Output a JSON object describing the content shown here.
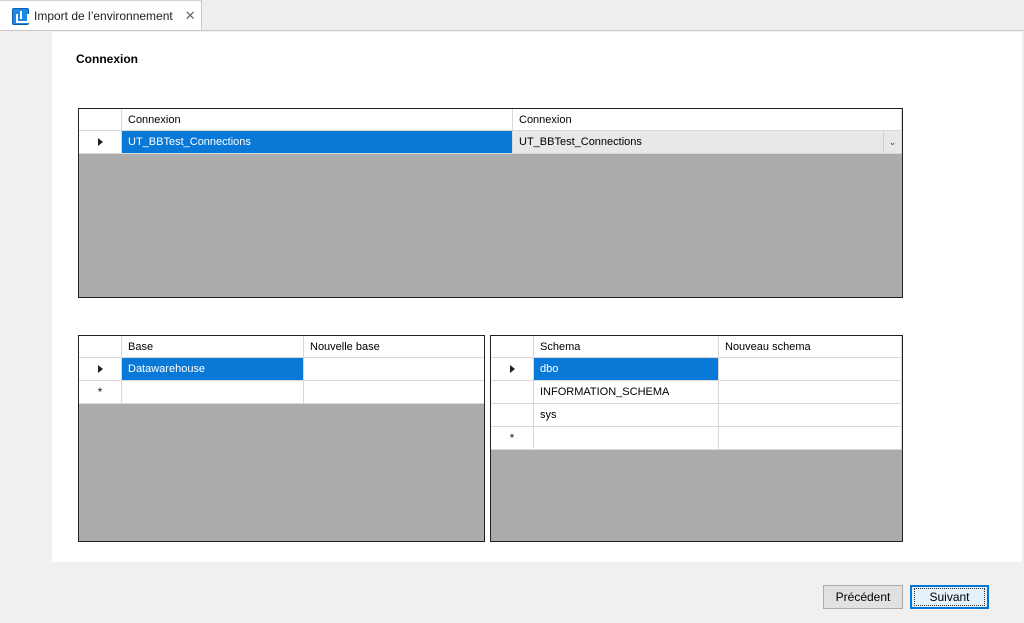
{
  "tab": {
    "title": "Import de l’environnement",
    "close": "✕"
  },
  "section_title": "Connexion",
  "connection_grid": {
    "headers": [
      "Connexion",
      "Connexion"
    ],
    "rows": [
      {
        "source": "UT_BBTest_Connections",
        "target": "UT_BBTest_Connections"
      }
    ]
  },
  "base_grid": {
    "headers": [
      "Base",
      "Nouvelle base"
    ],
    "rows": [
      {
        "base": "Datawarehouse",
        "new_base": ""
      }
    ]
  },
  "schema_grid": {
    "headers": [
      "Schema",
      "Nouveau schema"
    ],
    "rows": [
      {
        "schema": "dbo",
        "new_schema": ""
      },
      {
        "schema": "INFORMATION_SCHEMA",
        "new_schema": ""
      },
      {
        "schema": "sys",
        "new_schema": ""
      }
    ]
  },
  "new_row_marker": "*",
  "buttons": {
    "previous": "Précédent",
    "next": "Suivant"
  },
  "colors": {
    "selection": "#0a78d7",
    "grid_background": "#ababab",
    "accent": "#1e88e5"
  }
}
